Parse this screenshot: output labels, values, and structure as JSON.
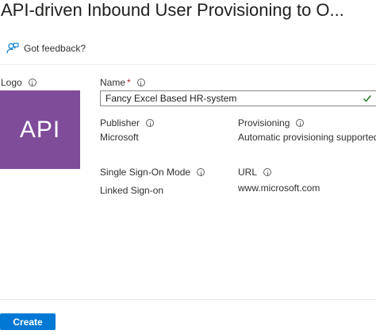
{
  "header": {
    "title": "API-driven Inbound User Provisioning to O..."
  },
  "toolbar": {
    "feedback_label": "Got feedback?"
  },
  "logo": {
    "label": "Logo",
    "tile_text": "API",
    "tile_color": "#7e4c99"
  },
  "name": {
    "label": "Name",
    "required_marker": "*",
    "value": "Fancy Excel Based HR-system",
    "valid": true
  },
  "publisher": {
    "label": "Publisher",
    "value": "Microsoft"
  },
  "provisioning": {
    "label": "Provisioning",
    "value": "Automatic provisioning supported"
  },
  "sso": {
    "label": "Single Sign-On Mode",
    "value": "Linked Sign-on"
  },
  "url": {
    "label": "URL",
    "value": "www.microsoft.com"
  },
  "footer": {
    "create_label": "Create"
  },
  "colors": {
    "primary": "#0078d4",
    "success": "#107c10",
    "required": "#a4262c"
  }
}
